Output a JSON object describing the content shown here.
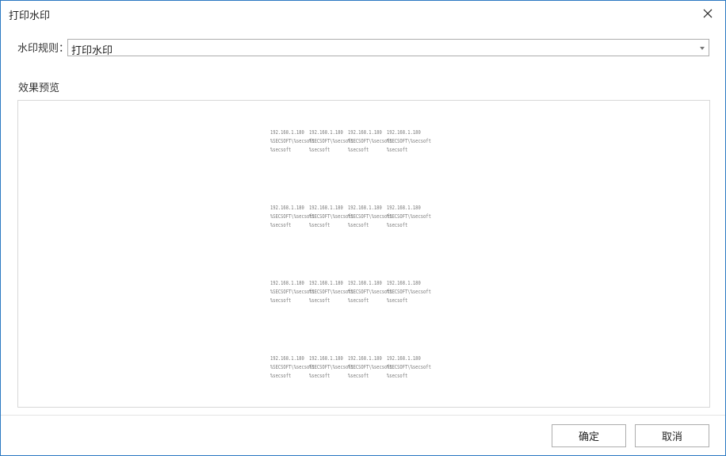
{
  "dialog": {
    "title": "打印水印",
    "close_icon": "close-icon"
  },
  "rule": {
    "label": "水印规则：",
    "selected": "打印水印"
  },
  "preview": {
    "label": "效果预览",
    "watermark_lines": [
      "192.168.1.180",
      "%SECSOFT\\%secsoft",
      "%secsoft"
    ]
  },
  "buttons": {
    "ok": "确定",
    "cancel": "取消"
  },
  "colors": {
    "border_accent": "#2b79c2"
  }
}
